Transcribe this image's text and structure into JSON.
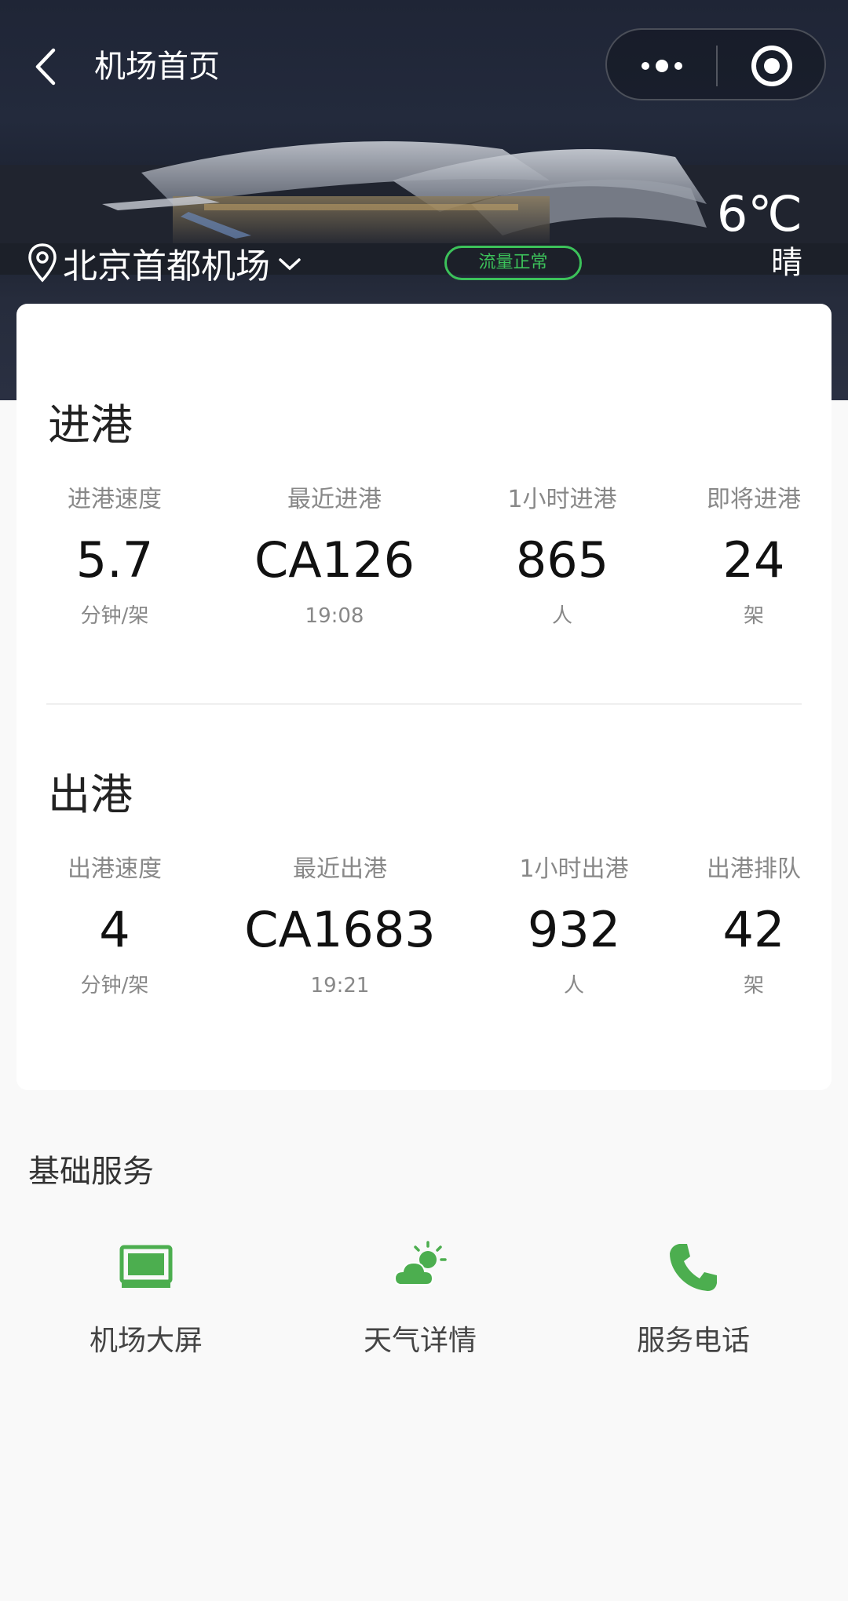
{
  "nav": {
    "title": "机场首页"
  },
  "header": {
    "airport_name": "北京首都机场",
    "flow_status": "流量正常",
    "temperature": "6℃",
    "weather": "晴"
  },
  "arrival": {
    "title": "进港",
    "stats": [
      {
        "label": "进港速度",
        "value": "5.7",
        "unit": "分钟/架"
      },
      {
        "label": "最近进港",
        "value": "CA126",
        "unit": "19:08"
      },
      {
        "label": "1小时进港",
        "value": "865",
        "unit": "人"
      },
      {
        "label": "即将进港",
        "value": "24",
        "unit": "架"
      }
    ]
  },
  "departure": {
    "title": "出港",
    "stats": [
      {
        "label": "出港速度",
        "value": "4",
        "unit": "分钟/架"
      },
      {
        "label": "最近出港",
        "value": "CA1683",
        "unit": "19:21"
      },
      {
        "label": "1小时出港",
        "value": "932",
        "unit": "人"
      },
      {
        "label": "出港排队",
        "value": "42",
        "unit": "架"
      }
    ]
  },
  "services": {
    "title": "基础服务",
    "items": [
      {
        "label": "机场大屏",
        "icon": "screen-icon"
      },
      {
        "label": "天气详情",
        "icon": "weather-icon"
      },
      {
        "label": "服务电话",
        "icon": "phone-icon"
      }
    ]
  },
  "colors": {
    "accent_green": "#3cc25a",
    "header_bg": "#1f2536"
  }
}
